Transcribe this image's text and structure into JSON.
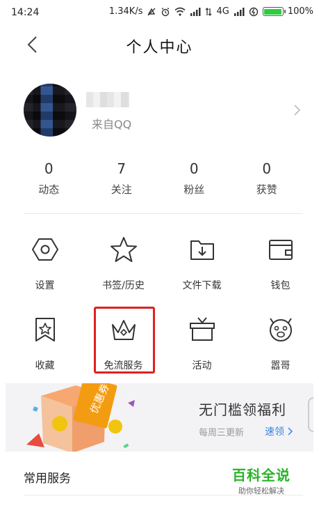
{
  "status_bar": {
    "time": "14:24",
    "speed": "1.34K/s",
    "network": "4G",
    "battery_text": "100%",
    "battery_level": 1.0,
    "battery_color": "#2ecc40"
  },
  "nav": {
    "title": "个人中心"
  },
  "profile": {
    "source": "来自QQ"
  },
  "stats": [
    {
      "value": "0",
      "label": "动态"
    },
    {
      "value": "7",
      "label": "关注"
    },
    {
      "value": "0",
      "label": "粉丝"
    },
    {
      "value": "0",
      "label": "获赞"
    }
  ],
  "grid": [
    {
      "icon": "hexagon-settings-icon",
      "label": "设置"
    },
    {
      "icon": "star-icon",
      "label": "书签/历史"
    },
    {
      "icon": "folder-download-icon",
      "label": "文件下载"
    },
    {
      "icon": "wallet-icon",
      "label": "钱包"
    },
    {
      "icon": "bookmark-star-icon",
      "label": "收藏"
    },
    {
      "icon": "crown-icon",
      "label": "免流服务"
    },
    {
      "icon": "gift-box-icon",
      "label": "活动"
    },
    {
      "icon": "mascot-face-icon",
      "label": "嚣哥"
    }
  ],
  "banner": {
    "title": "无门槛领福利",
    "subtitle": "每周三更新",
    "link": "速领",
    "coupon_text": "优惠券"
  },
  "common_services": {
    "title": "常用服务"
  },
  "watermark": {
    "main": "百科全说",
    "sub": "助你轻松解决"
  },
  "colors": {
    "highlight": "#e02020",
    "link": "#3a86e0",
    "watermark": "#28b428"
  }
}
